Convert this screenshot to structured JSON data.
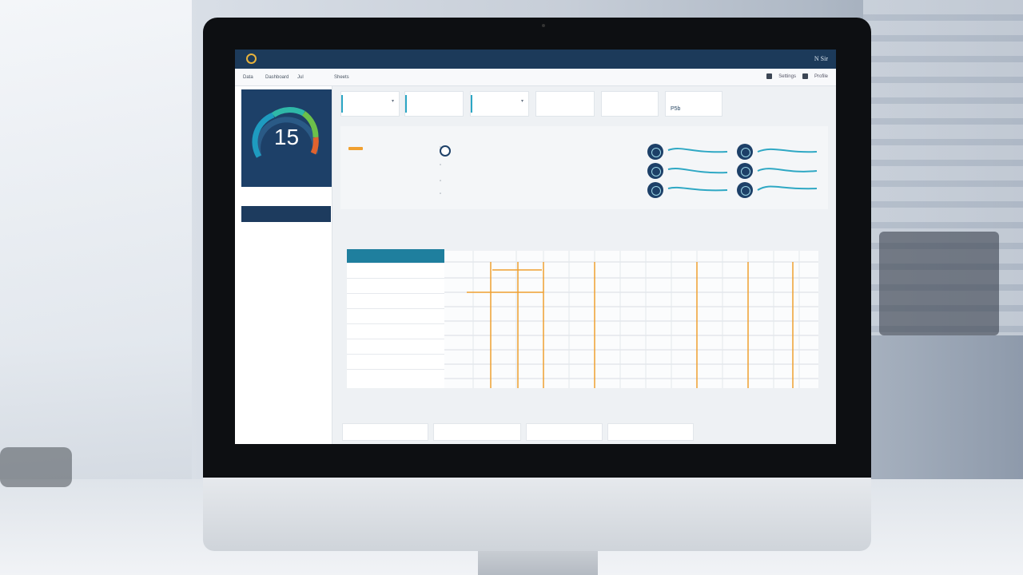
{
  "window": {
    "app_title": "",
    "user_name": "N Sir"
  },
  "crumbs": [
    "Data",
    "Dashboard",
    "Jul",
    "Sheets"
  ],
  "crumb_actions": [
    "Settings",
    "Profile"
  ],
  "gauge": {
    "value": "15",
    "sublabel": ""
  },
  "sidebar": {
    "heading": "",
    "active": {
      "label": "",
      "value": ""
    },
    "items": [
      {
        "label": "",
        "value": ""
      },
      {
        "label": "",
        "value": ""
      },
      {
        "label": "",
        "value": ""
      },
      {
        "label": "",
        "value": ""
      },
      {
        "label": "",
        "value": ""
      },
      {
        "label": "",
        "value": ""
      }
    ]
  },
  "filters": [
    {
      "title": "",
      "sub": ""
    },
    {
      "title": "",
      "sub": ""
    },
    {
      "title": "",
      "sub": ""
    },
    {
      "title": "",
      "sub": ""
    },
    {
      "title": "",
      "sub": ""
    },
    {
      "title": "",
      "sub": "P5b"
    }
  ],
  "summary": {
    "title": "",
    "rows": [
      {
        "label": "",
        "value": ""
      },
      {
        "label": "",
        "value": ""
      },
      {
        "label": "",
        "value": ""
      },
      {
        "label": "",
        "value": ""
      }
    ],
    "mid_heading": "",
    "mid_sub": "",
    "kpi_left_label": "",
    "kpi_right_label": ""
  },
  "table": {
    "title": "",
    "right_text": "",
    "header_label": "",
    "columns": [
      "",
      "",
      "",
      "",
      "",
      "",
      "",
      "",
      "",
      "",
      "",
      "",
      "",
      ""
    ],
    "rows": [
      {
        "label": "",
        "value": ""
      },
      {
        "label": "",
        "value": ""
      },
      {
        "label": "",
        "value": ""
      },
      {
        "label": "",
        "value": ""
      },
      {
        "label": "",
        "value": ""
      },
      {
        "label": "",
        "value": ""
      },
      {
        "label": "",
        "value": ""
      },
      {
        "label": "",
        "value": ""
      }
    ]
  },
  "bottom": {
    "title": "",
    "right_text": "",
    "cards": [
      "",
      "",
      "",
      ""
    ]
  },
  "colors": {
    "navy": "#1c3a5a",
    "teal": "#1f7f9e",
    "accent_orange": "#f0a030",
    "gauge_green": "#6cc04a"
  }
}
